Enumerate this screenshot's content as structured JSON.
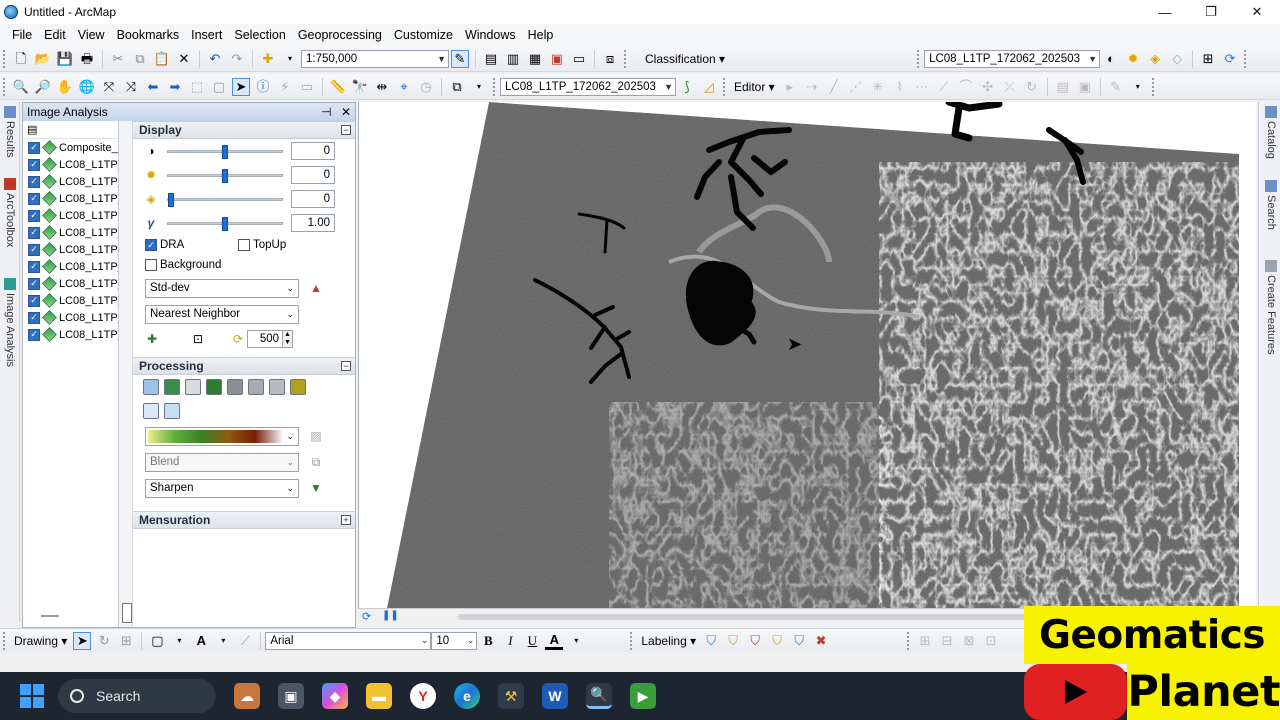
{
  "window": {
    "title": "Untitled - ArcMap",
    "minimize": "—",
    "maximize": "❐",
    "close": "✕"
  },
  "menu": [
    "File",
    "Edit",
    "View",
    "Bookmarks",
    "Insert",
    "Selection",
    "Geoprocessing",
    "Customize",
    "Windows",
    "Help"
  ],
  "toolbar1": {
    "scale": "1:750,000",
    "classification_label": "Classification ▾",
    "layer_combo": "LC08_L1TP_172062_202503"
  },
  "toolbar2": {
    "layer_combo": "LC08_L1TP_172062_202503",
    "editor_label": "Editor ▾"
  },
  "left_dock_tabs": [
    "Results",
    "ArcToolbox",
    "Image Analysis"
  ],
  "right_dock_tabs": [
    "Catalog",
    "Search",
    "Create Features"
  ],
  "image_analysis": {
    "title": "Image Analysis",
    "pin": "⊣",
    "close": "✕",
    "layers": [
      "Composite_",
      "LC08_L1TP_",
      "LC08_L1TP_",
      "LC08_L1TP_",
      "LC08_L1TP_",
      "LC08_L1TP_",
      "LC08_L1TP_",
      "LC08_L1TP_",
      "LC08_L1TP_",
      "LC08_L1TP_",
      "LC08_L1TP_",
      "LC08_L1TP_"
    ],
    "display": {
      "title": "Display",
      "contrast": {
        "value": "0",
        "level": 0.5
      },
      "brightness": {
        "value": "0",
        "level": 0.5
      },
      "transparency": {
        "value": "0",
        "level": 0.0
      },
      "gamma": {
        "value": "1.00",
        "level": 0.5,
        "icon": "γ"
      },
      "dra_label": "DRA",
      "dra_checked": true,
      "topup_label": "TopUp",
      "topup_checked": false,
      "background_label": "Background",
      "background_checked": false,
      "stretch": "Std-dev",
      "resampling": "Nearest Neighbor",
      "zoom_value": "500"
    },
    "processing": {
      "title": "Processing",
      "blend": "Blend",
      "sharpen": "Sharpen"
    },
    "mensuration": {
      "title": "Mensuration"
    }
  },
  "drawing_bar": {
    "drawing_label": "Drawing ▾",
    "font": "Arial",
    "font_size": "10",
    "bold": "B",
    "italic": "I",
    "underline": "U",
    "font_color_label": "A",
    "labeling_label": "Labeling ▾"
  },
  "taskbar": {
    "search_placeholder": "Search"
  },
  "watermark": {
    "line1": "Geomatics",
    "line2": "Planet"
  }
}
